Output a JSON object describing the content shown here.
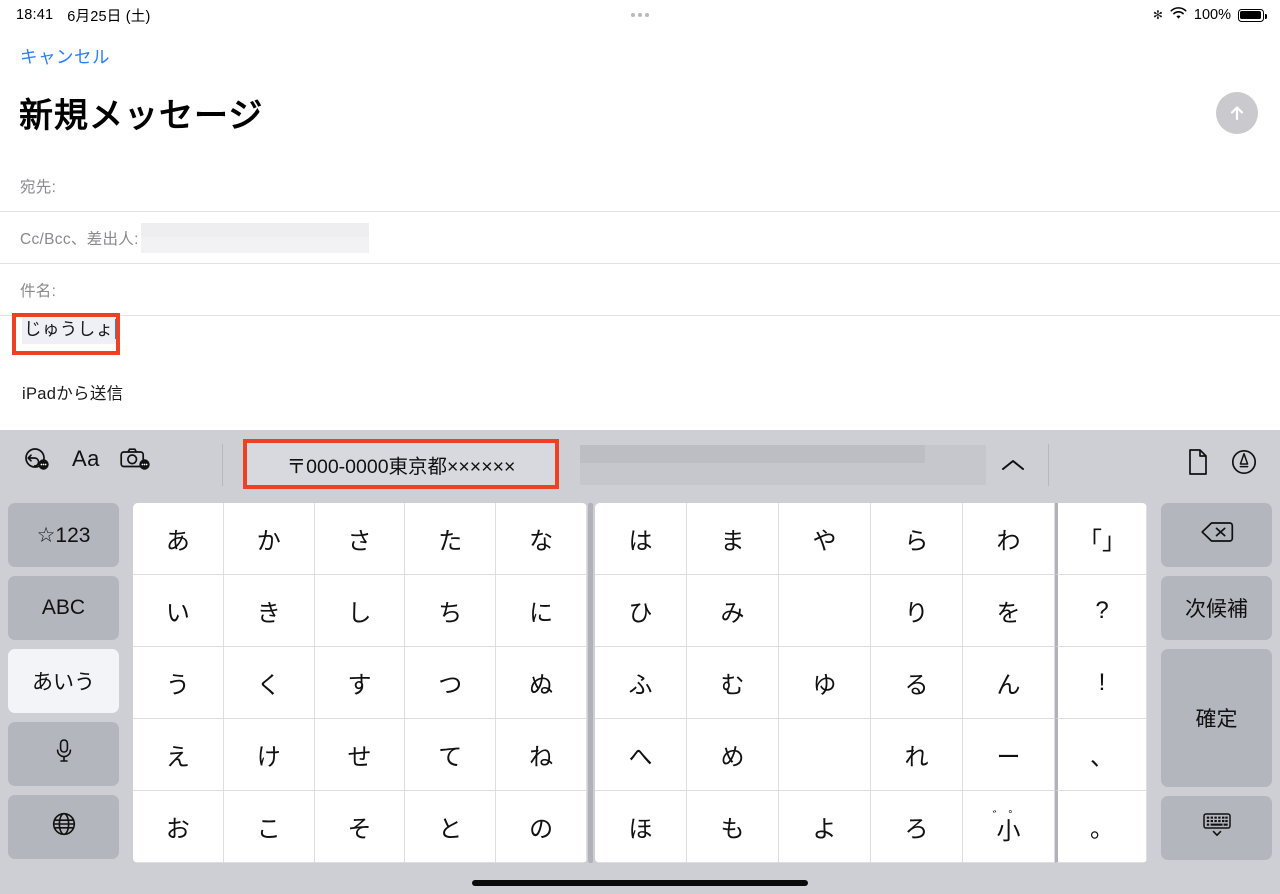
{
  "status_bar": {
    "time": "18:41",
    "date": "6月25日 (土)",
    "battery_percent": "100%",
    "icons": [
      "bluetooth-icon",
      "wifi-icon",
      "battery-icon"
    ]
  },
  "compose": {
    "cancel_label": "キャンセル",
    "title": "新規メッセージ",
    "send_label": "send-arrow",
    "fields": [
      {
        "label": "宛先:",
        "value": "",
        "redacted": false
      },
      {
        "label": "Cc/Bcc、差出人:",
        "value": "",
        "redacted": true
      },
      {
        "label": "件名:",
        "value": "",
        "redacted": false
      }
    ],
    "body_text": "じゅうしょ",
    "signature": "iPadから送信"
  },
  "annotations": [
    {
      "name": "body-composition-highlight",
      "color": "#ec4123"
    },
    {
      "name": "suggestion-highlight",
      "color": "#ec4123"
    }
  ],
  "keyboard": {
    "toolbar": {
      "left_icons": [
        "undo-emoji-icon",
        "text-format-icon",
        "camera-emoji-icon"
      ],
      "format_label": "Aa",
      "suggestion": "〒000-0000東京都××××××",
      "candidates_redacted": true,
      "expand_label": "∧",
      "right_icons": [
        "document-icon",
        "markup-pen-icon"
      ]
    },
    "left_column": [
      {
        "label": "☆123",
        "name": "key-symbols",
        "active": false
      },
      {
        "label": "ABC",
        "name": "key-abc",
        "active": false
      },
      {
        "label": "あいう",
        "name": "key-kana",
        "active": true
      },
      {
        "label": "",
        "name": "key-dictation",
        "icon": "microphone-icon",
        "active": false
      },
      {
        "label": "",
        "name": "key-globe",
        "icon": "globe-icon",
        "active": false
      }
    ],
    "right_column": [
      {
        "label": "",
        "name": "key-delete",
        "icon": "delete-backward-icon"
      },
      {
        "label": "次候補",
        "name": "key-next-candidate"
      },
      {
        "label": "確定",
        "name": "key-confirm"
      },
      {
        "label": "",
        "name": "key-hide-keyboard",
        "icon": "hide-keyboard-icon"
      }
    ],
    "kana_left": [
      [
        "あ",
        "か",
        "さ",
        "た",
        "な"
      ],
      [
        "い",
        "き",
        "し",
        "ち",
        "に"
      ],
      [
        "う",
        "く",
        "す",
        "つ",
        "ぬ"
      ],
      [
        "え",
        "け",
        "せ",
        "て",
        "ね"
      ],
      [
        "お",
        "こ",
        "そ",
        "と",
        "の"
      ]
    ],
    "kana_right": [
      [
        "は",
        "ま",
        "や",
        "ら",
        "わ",
        "「」"
      ],
      [
        "ひ",
        "み",
        "",
        "り",
        "を",
        "?"
      ],
      [
        "ふ",
        "む",
        "ゆ",
        "る",
        "ん",
        "!"
      ],
      [
        "へ",
        "め",
        "",
        "れ",
        "ー",
        "、"
      ],
      [
        "ほ",
        "も",
        "よ",
        "ろ",
        "゛゜小",
        "。"
      ]
    ]
  },
  "colors": {
    "accent_blue": "#2d7ef7",
    "annotation_red": "#ec4123",
    "keyboard_bg": "#cdcfd4",
    "key_grey": "#b3b6bd"
  }
}
